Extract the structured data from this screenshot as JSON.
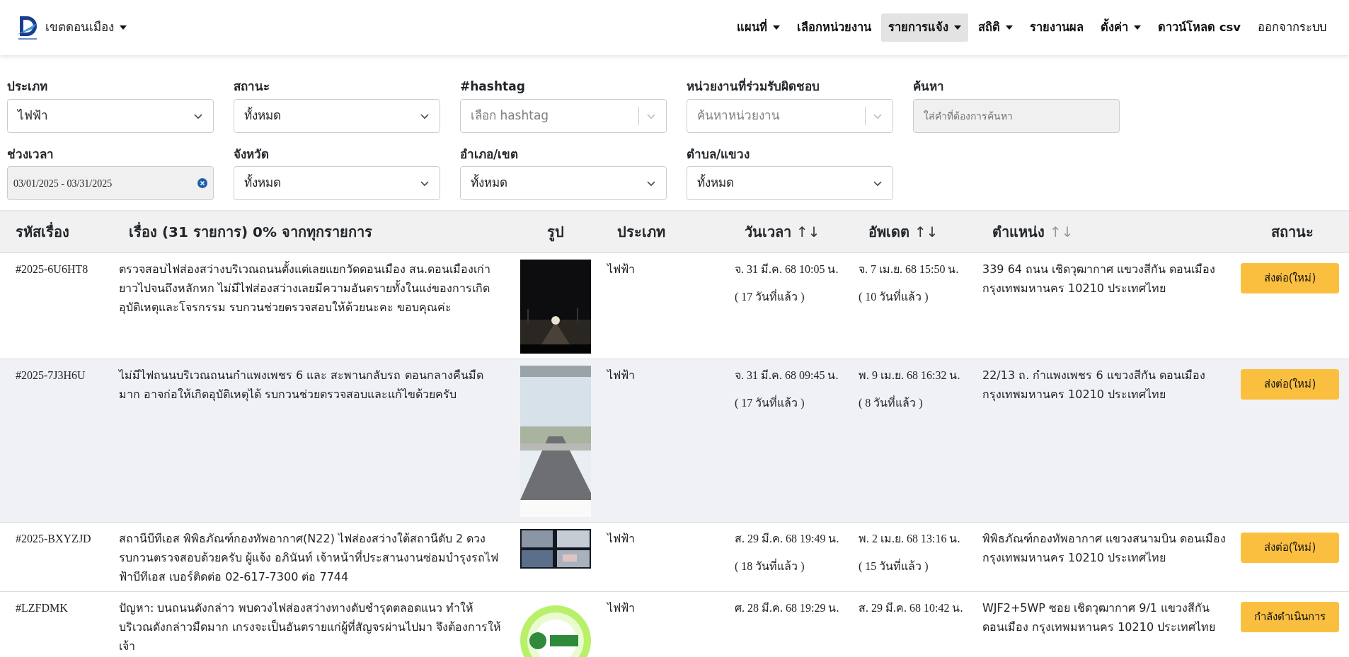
{
  "brand": {
    "label": "เขตดอนเมือง",
    "dropdown": true
  },
  "nav": [
    {
      "label": "แผนที่",
      "kind": "menu",
      "dropdown": true,
      "selected": false
    },
    {
      "label": "เลือกหน่วยงาน",
      "kind": "menu",
      "dropdown": false,
      "selected": false
    },
    {
      "label": "รายการแจ้ง",
      "kind": "menu",
      "dropdown": true,
      "selected": true
    },
    {
      "label": "สถิติ",
      "kind": "menu",
      "dropdown": true,
      "selected": false
    },
    {
      "label": "รายงานผล",
      "kind": "menu",
      "dropdown": false,
      "selected": false
    },
    {
      "label": "ตั้งค่า",
      "kind": "menu",
      "dropdown": true,
      "selected": false
    },
    {
      "label": "ดาวน์โหลด csv",
      "kind": "menu",
      "dropdown": false,
      "selected": false
    },
    {
      "label": "ออกจากระบบ",
      "kind": "plain",
      "dropdown": false,
      "selected": false
    }
  ],
  "filters": [
    {
      "label": "ประเภท",
      "kind": "select",
      "value": "ไฟฟ้า"
    },
    {
      "label": "สถานะ",
      "kind": "select",
      "value": "ทั้งหมด"
    },
    {
      "label": "#hashtag",
      "kind": "multiselect",
      "placeholder": "เลือก hashtag"
    },
    {
      "label": "หน่วยงานที่ร่วมรับผิดชอบ",
      "kind": "multiselect",
      "placeholder": "ค้นหาหน่วยงาน"
    },
    {
      "label": "ค้นหา",
      "kind": "text",
      "placeholder": "ใส่คำที่ต้องการค้นหา"
    },
    {
      "label": "ช่วงเวลา",
      "kind": "daterange",
      "value": "03/01/2025 - 03/31/2025"
    },
    {
      "label": "จังหวัด",
      "kind": "select",
      "value": "ทั้งหมด"
    },
    {
      "label": "อำเภอ/เขต",
      "kind": "select",
      "value": "ทั้งหมด"
    },
    {
      "label": "ตำบล/แขวง",
      "kind": "select",
      "value": "ทั้งหมด"
    }
  ],
  "table": {
    "columns": [
      {
        "label": "รหัสเรื่อง"
      },
      {
        "label": "เรื่อง (31 รายการ) 0% จากทุกรายการ"
      },
      {
        "label": "รูป"
      },
      {
        "label": "ประเภท"
      },
      {
        "label": "วันเวลา",
        "sort_icon": "↑↓",
        "sort_active": true
      },
      {
        "label": "อัพเดต",
        "sort_icon": "↑↓",
        "sort_active": true
      },
      {
        "label": "ตำแหน่ง",
        "sort_icon": "↑↓",
        "sort_active": false
      },
      {
        "label": "สถานะ"
      }
    ],
    "rows": [
      {
        "id": "#2025-6U6HT8",
        "description": "ตรวจสอบไฟส่องสว่างบริเวณถนนตั้งแต่เลยแยกวัดดอนเมือง สน.ดอนเมืองเก่ายาวไปจนถึงหลักหก ไม่มีไฟส่องสว่างเลยมีความอันตรายทั้งในแง่ของการเกิดอุบัติเหตุและโจรกรรม รบกวนช่วยตรวจสอบให้ด้วยนะคะ ขอบคุณค่ะ",
        "type": "ไฟฟ้า",
        "created": "จ. 31 มี.ค. 68 10:05 น.",
        "created_ago": "( 17 วันที่แล้ว )",
        "updated": "จ. 7 เม.ย. 68 15:50 น.",
        "updated_ago": "( 10 วันที่แล้ว )",
        "location": "339 64 ถนน เชิดวุฒากาศ แขวงสีกัน ดอนเมือง กรุงเทพมหานคร 10210 ประเทศไทย",
        "status": "ส่งต่อ(ใหม่)",
        "highlighted": false
      },
      {
        "id": "#2025-7J3H6U",
        "description": "ไม่มีไฟถนนบริเวณถนนกำแพงเพชร 6 และ สะพานกลับรถ ตอนกลางคืนมืดมาก อาจก่อให้เกิดอุบัติเหตุได้ รบกวนช่วยตรวจสอบและแก้ไขด้วยครับ",
        "type": "ไฟฟ้า",
        "created": "จ. 31 มี.ค. 68 09:45 น.",
        "created_ago": "( 17 วันที่แล้ว )",
        "updated": "พ. 9 เม.ย. 68 16:32 น.",
        "updated_ago": "( 8 วันที่แล้ว )",
        "location": "22/13 ถ. กำแพงเพชร 6 แขวงสีกัน ดอนเมือง กรุงเทพมหานคร 10210 ประเทศไทย",
        "status": "ส่งต่อ(ใหม่)",
        "highlighted": true
      },
      {
        "id": "#2025-BXYZJD",
        "description": "สถานีบีทีเอส พิพิธภัณฑ์กองทัพอากาศ(N22) ไฟส่องสว่างใต้สถานีดับ 2 ดวง รบกวนตรวจสอบด้วยครับ ผู้แจ้ง อภินันท์ เจ้าหน้าที่ประสานงานซ่อมบำรุงรถไฟฟ้าบีทีเอส เบอร์ติดต่อ 02-617-7300 ต่อ 7744",
        "type": "ไฟฟ้า",
        "created": "ส. 29 มี.ค. 68 19:49 น.",
        "created_ago": "( 18 วันที่แล้ว )",
        "updated": "พ. 2 เม.ย. 68 13:16 น.",
        "updated_ago": "( 15 วันที่แล้ว )",
        "location": "พิพิธภัณฑ์กองทัพอากาศ แขวงสนามบิน ดอนเมือง กรุงเทพมหานคร 10210 ประเทศไทย",
        "status": "ส่งต่อ(ใหม่)",
        "highlighted": false
      },
      {
        "id": "#LZFDMK",
        "description": "ปัญหา: บนถนนดังกล่าว พบดวงไฟส่องสว่างทางดับชำรุดตลอดแนว ทำให้บริเวณดังกล่าวมืดมาก เกรงจะเป็นอันตรายแก่ผู้ที่สัญจรผ่านไปมา จึงต้องการให้เจ้า",
        "type": "ไฟฟ้า",
        "created": "ศ. 28 มี.ค. 68 19:29 น.",
        "updated": "ส. 29 มี.ค. 68 10:42 น.",
        "location": "WJF2+5WP ซอย เชิดวุฒากาศ 9/1 แขวงสีกัน ดอนเมือง กรุงเทพมหานคร 10210 ประเทศไทย",
        "status": "กำลังดำเนินการ",
        "highlighted": false
      }
    ]
  }
}
